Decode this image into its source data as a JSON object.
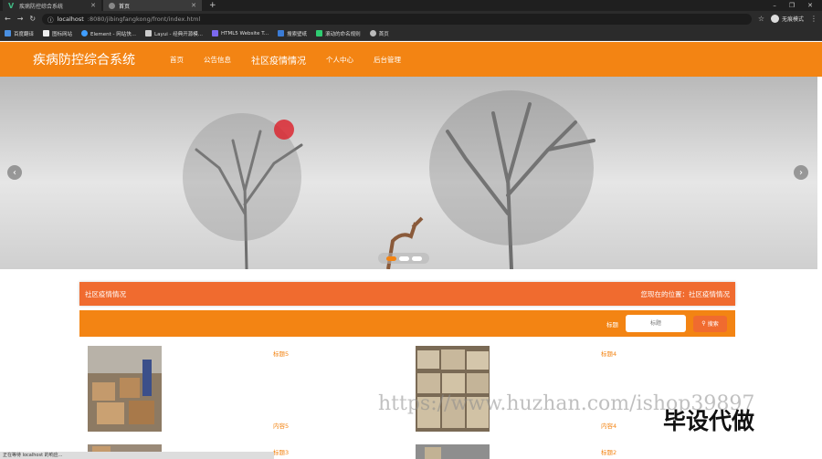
{
  "browser": {
    "tabs": [
      {
        "label": "疾病防控综合系统",
        "active": false
      },
      {
        "label": "首页",
        "active": true
      }
    ],
    "address": {
      "host": "localhost",
      "path": ":8080/jibingfangkong/front/index.html"
    },
    "profile_label": "无痕模式",
    "bookmarks": [
      "百度翻译",
      "图标网站",
      "Element - 网站快...",
      "Layui - 经典开源模...",
      "HTML5 Website T...",
      "搜索壁纸",
      "滚动的命名规则",
      "首页"
    ]
  },
  "site": {
    "logo": "疾病防控综合系统",
    "nav": [
      "首页",
      "公告信息",
      "社区疫情情况",
      "个人中心",
      "后台管理"
    ],
    "active_nav": 2
  },
  "banner": {
    "prev": "‹",
    "next": "›",
    "slide_count": 3,
    "active_slide": 0
  },
  "section": {
    "title": "社区疫情情况",
    "breadcrumb": "您现在的位置：社区疫情情况"
  },
  "search": {
    "label": "标题",
    "placeholder": "标题",
    "button": "搜索"
  },
  "cards": [
    {
      "title": "标题5",
      "content": "内容5"
    },
    {
      "title": "标题4",
      "content": "内容4"
    },
    {
      "title": "标题3",
      "content": ""
    },
    {
      "title": "标题2",
      "content": ""
    }
  ],
  "status_text": "正在等待 localhost 的响应...",
  "watermark": {
    "url": "https://www.huzhan.com/ishop39897",
    "text": "毕设代做"
  },
  "colors": {
    "accent": "#f38413",
    "accent_dark": "#f06b2f"
  }
}
